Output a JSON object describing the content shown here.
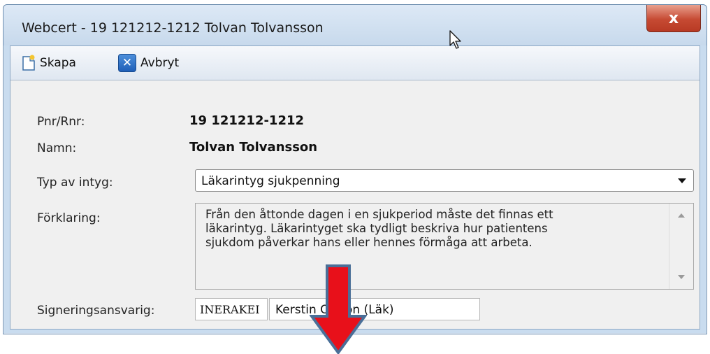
{
  "window": {
    "title": "Webcert - 19 121212-1212 Tolvan Tolvansson",
    "close_label": "x"
  },
  "toolbar": {
    "create_label": "Skapa",
    "cancel_label": "Avbryt"
  },
  "form": {
    "pnr_label": "Pnr/Rnr:",
    "pnr_value": "19  121212-1212",
    "name_label": "Namn:",
    "name_value": "Tolvan Tolvansson",
    "cert_type_label": "Typ av intyg:",
    "cert_type_selected": "Läkarintyg sjukpenning",
    "explanation_label": "Förklaring:",
    "explanation_lines": [
      "Från den åttonde dagen i en sjukperiod måste det finnas ett",
      "läkarintyg. Läkarintyget ska tydligt beskriva hur patientens",
      "sjukdom påverkar hans eller hennes förmåga att arbeta."
    ],
    "signer_label": "Signeringsansvarig:",
    "signer_code": "INERAKEI",
    "signer_name": "Kerstin Olsson (Läk)"
  },
  "icons": {
    "create": "new-document-icon",
    "cancel": "cancel-x-icon",
    "pointer": "mouse-pointer-icon",
    "highlight": "red-down-arrow-icon"
  },
  "colors": {
    "arrow_fill": "#e8101a",
    "arrow_stroke": "#4a6f98",
    "window_frame": "#c9dcef"
  }
}
